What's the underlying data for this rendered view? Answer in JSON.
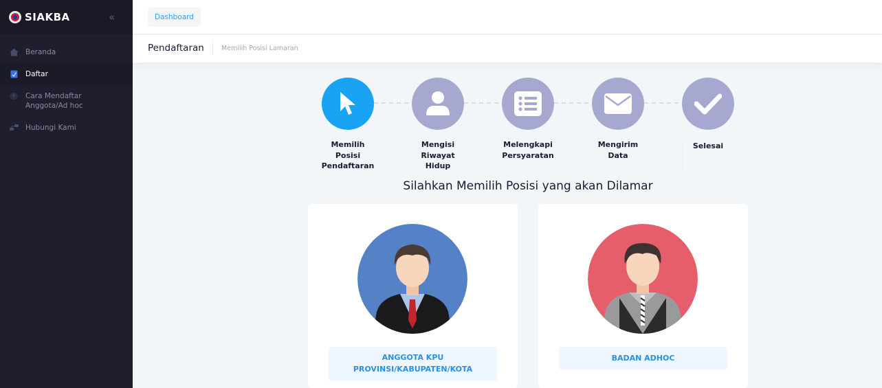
{
  "app": {
    "brand": "SIAKBA",
    "collapse_icon": "chevrons-left-icon"
  },
  "sidebar": {
    "items": [
      {
        "label": "Beranda",
        "icon": "home-icon",
        "active": false
      },
      {
        "label": "Daftar",
        "icon": "document-edit-icon",
        "active": true
      },
      {
        "label": "Cara Mendaftar\nAnggota/Ad hoc",
        "icon": "question-circle-icon",
        "active": false
      },
      {
        "label": "Hubungi Kami",
        "icon": "network-icon",
        "active": false
      }
    ]
  },
  "topbar": {
    "tab": "Dashboard"
  },
  "subheader": {
    "title": "Pendaftaran",
    "crumb": "Memilih Posisi Lamaran"
  },
  "wizard": {
    "steps": [
      {
        "label": "Memilih\nPosisi\nPendaftaran",
        "icon": "cursor-icon",
        "active": true
      },
      {
        "label": "Mengisi\nRiwayat\nHidup",
        "icon": "user-icon",
        "active": false
      },
      {
        "label": "Melengkapi\nPersyaratan",
        "icon": "list-icon",
        "active": false
      },
      {
        "label": "Mengirim\nData",
        "icon": "envelope-icon",
        "active": false
      },
      {
        "label": "Selesai",
        "icon": "check-icon",
        "active": false
      }
    ]
  },
  "heading": "Silahkan Memilih Posisi yang akan Dilamar",
  "cards": [
    {
      "button": "ANGGOTA KPU\nPROVINSI/KABUPATEN/KOTA",
      "avatar_color": "#5581c6"
    },
    {
      "button": "BADAN ADHOC",
      "avatar_color": "#e65d6b"
    }
  ],
  "colors": {
    "accent": "#1aa3f2",
    "step_inactive": "#a6a8cf",
    "sidebar_bg": "#1f1e2e"
  }
}
